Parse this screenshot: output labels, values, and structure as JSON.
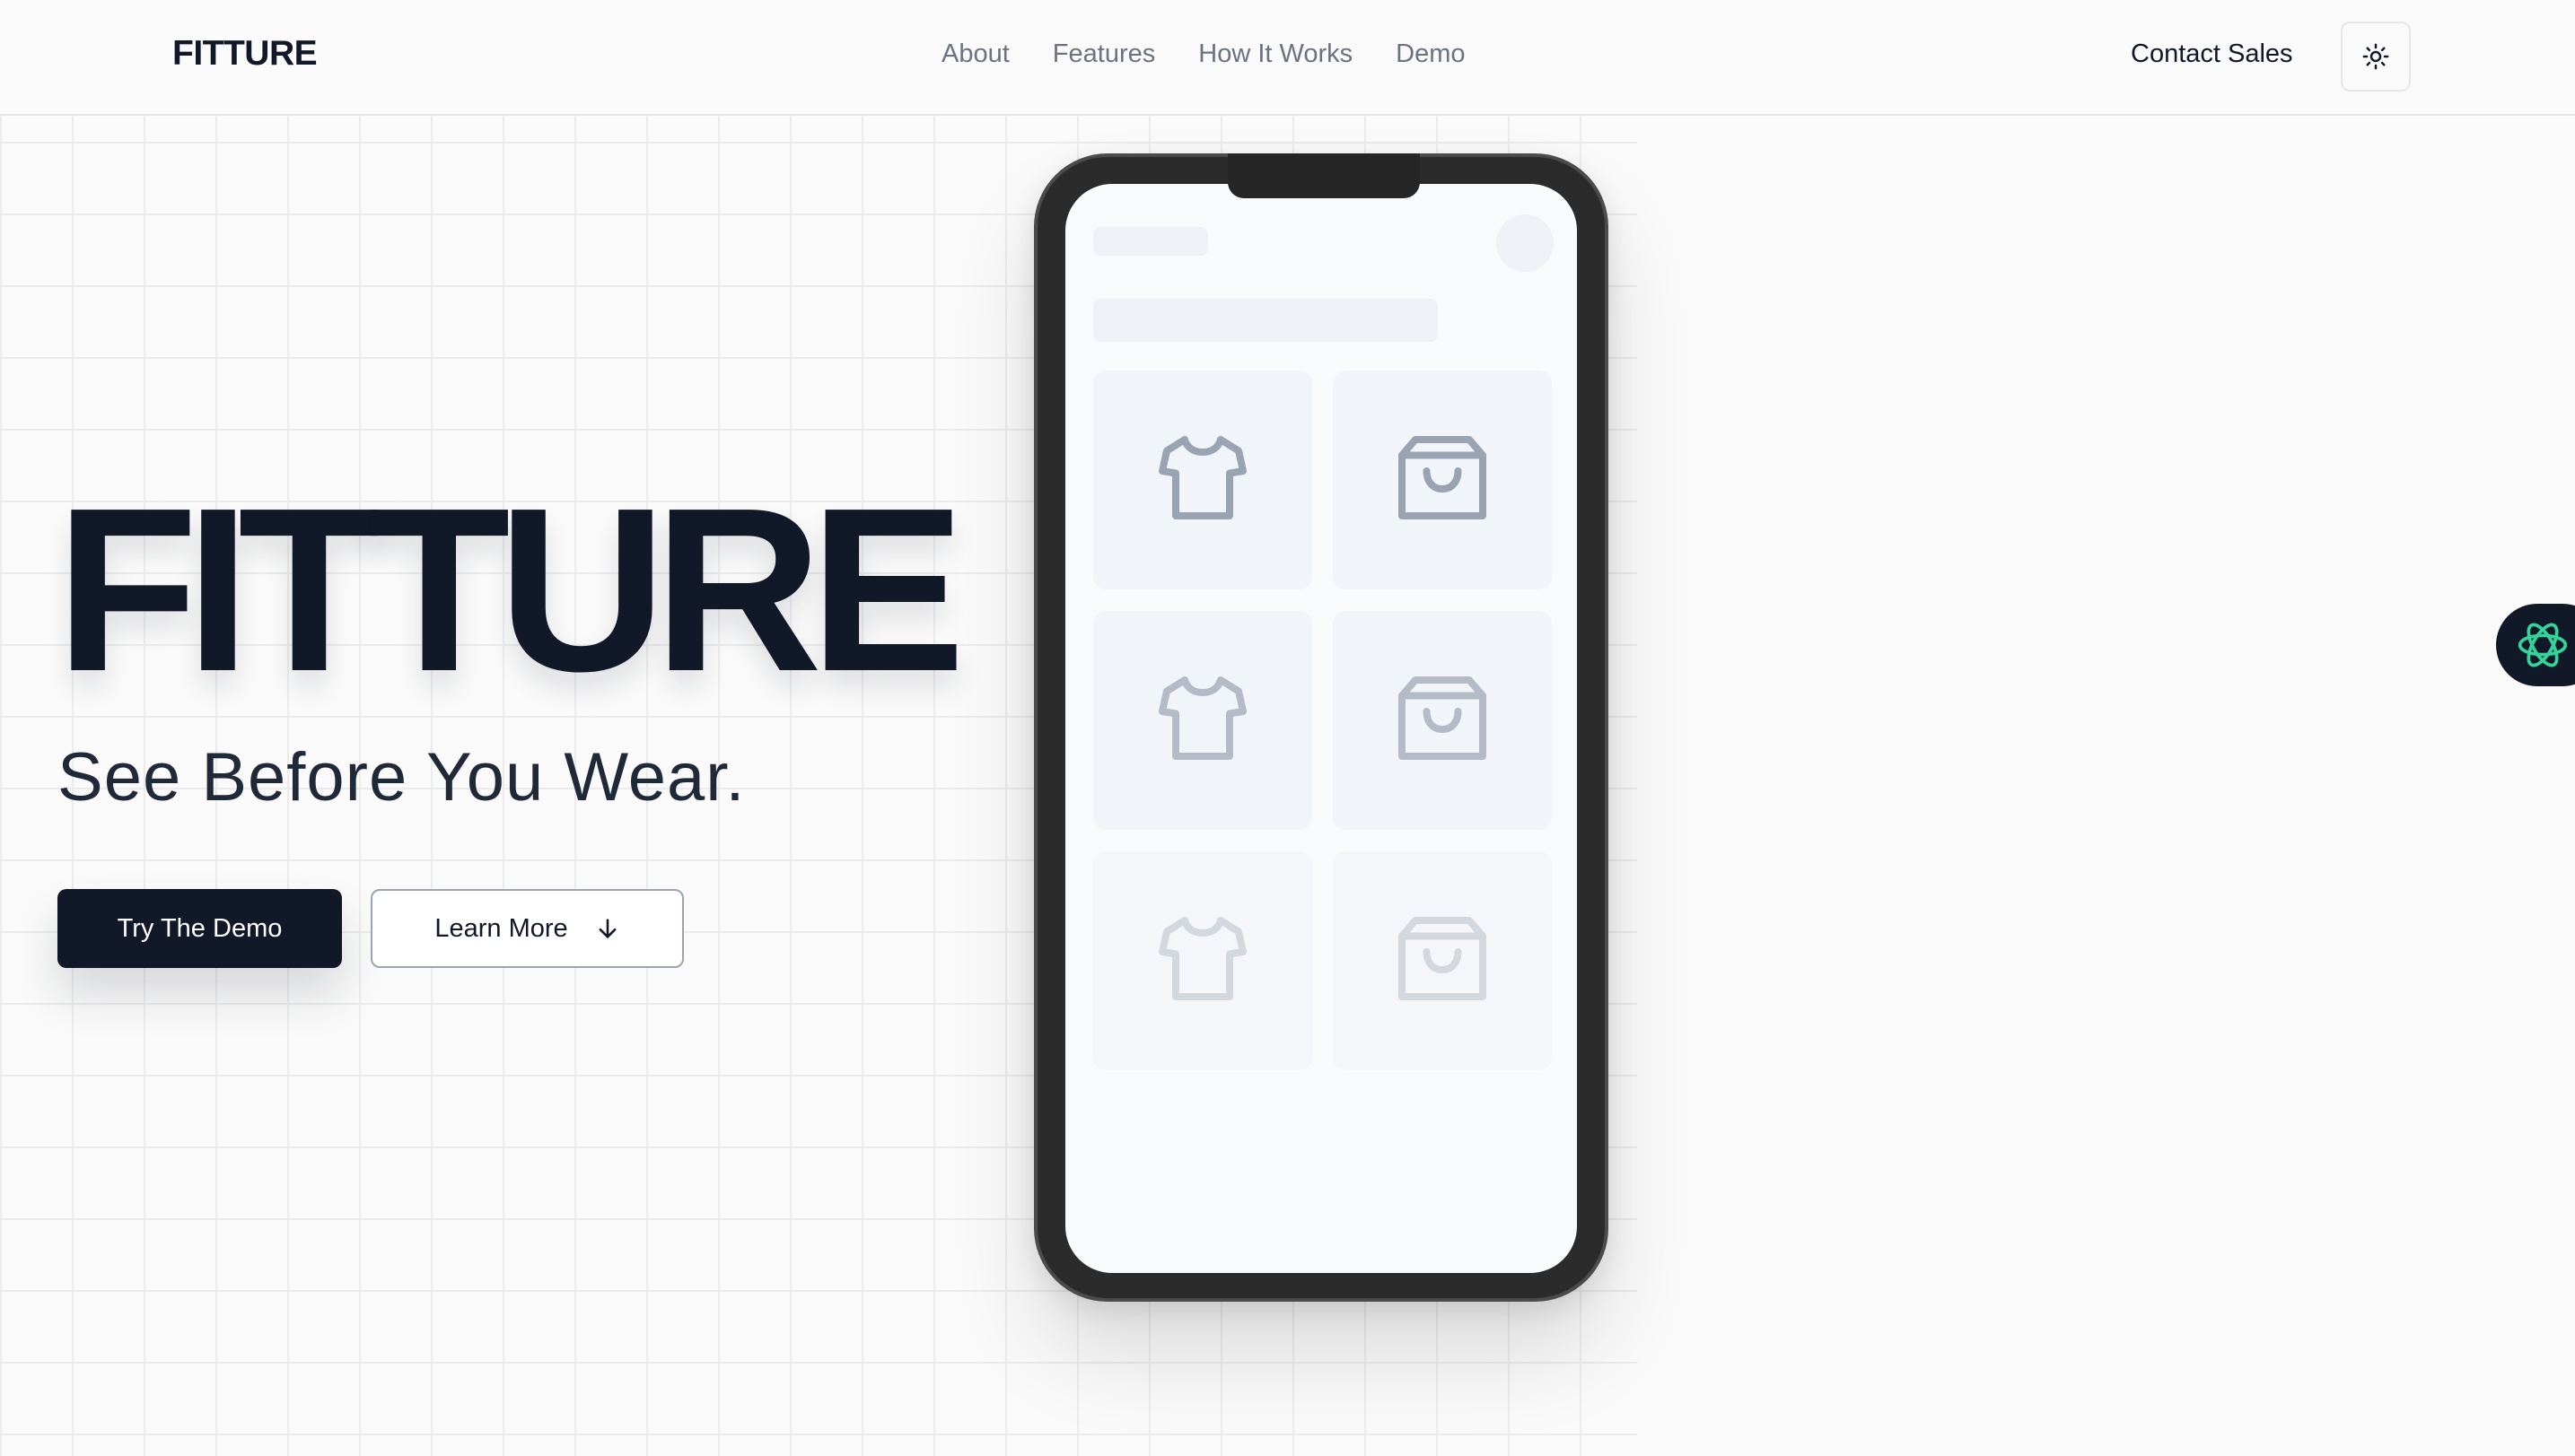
{
  "header": {
    "brand": "FITTURE",
    "nav": [
      {
        "label": "About"
      },
      {
        "label": "Features"
      },
      {
        "label": "How It Works"
      },
      {
        "label": "Demo"
      }
    ],
    "contact_label": "Contact Sales",
    "theme_toggle_icon": "sun-icon"
  },
  "hero": {
    "title": "FITTURE",
    "subtitle": "See Before You Wear.",
    "primary_button": "Try The Demo",
    "secondary_button": "Learn More",
    "secondary_button_icon": "arrow-down-icon"
  },
  "phone": {
    "tiles": [
      {
        "icon": "shirt-icon"
      },
      {
        "icon": "shopping-bag-icon"
      },
      {
        "icon": "shirt-icon"
      },
      {
        "icon": "shopping-bag-icon"
      },
      {
        "icon": "shirt-icon"
      },
      {
        "icon": "shopping-bag-icon"
      }
    ]
  },
  "widget": {
    "icon": "assistant-icon",
    "accent": "#34d399"
  },
  "colors": {
    "text_primary": "#111827",
    "nav_text": "#6b7280",
    "background": "#fafafa",
    "button_dark": "#111827"
  }
}
